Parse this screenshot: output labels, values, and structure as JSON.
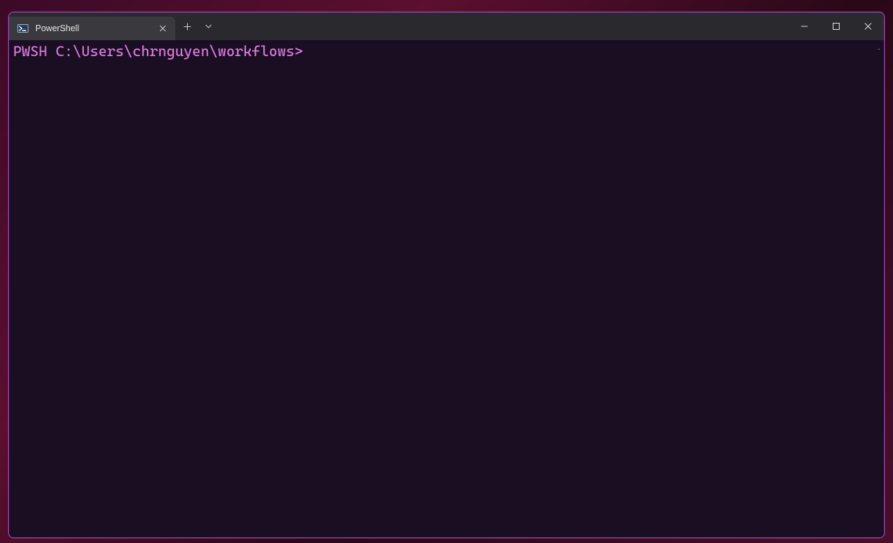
{
  "colors": {
    "window_border": "#a450c0",
    "titlebar_bg": "#2a2a2e",
    "tab_bg": "#3a3a3e",
    "terminal_bg": "#190e22",
    "prompt_fg": "#d877d8"
  },
  "tab": {
    "title": "PowerShell",
    "icon": "powershell-icon"
  },
  "terminal": {
    "prompt": "PWSH C:\\Users\\chrnguyen\\workflows>",
    "input": ""
  },
  "scroll_indicator": "-"
}
